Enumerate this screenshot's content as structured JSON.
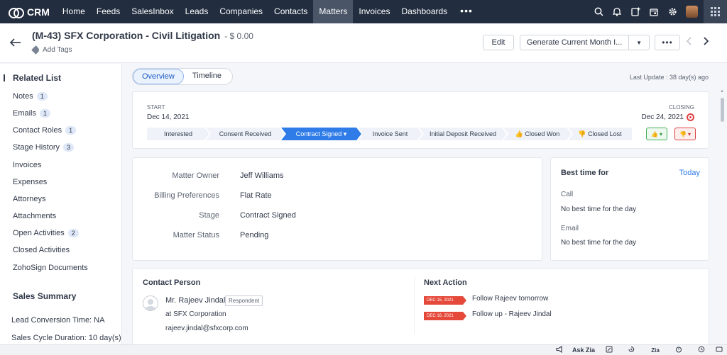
{
  "nav": {
    "app_name": "CRM",
    "tabs": [
      {
        "label": "Home"
      },
      {
        "label": "Feeds"
      },
      {
        "label": "SalesInbox"
      },
      {
        "label": "Leads"
      },
      {
        "label": "Companies"
      },
      {
        "label": "Contacts"
      },
      {
        "label": "Matters",
        "active": true
      },
      {
        "label": "Invoices"
      },
      {
        "label": "Dashboards"
      }
    ],
    "more": "•••"
  },
  "record": {
    "title": "(M-43) SFX Corporation - Civil Litigation",
    "amount": "- $ 0.00",
    "add_tags": "Add Tags",
    "edit": "Edit",
    "generate": "Generate Current Month I..."
  },
  "sidebar": {
    "related_title": "Related List",
    "items": [
      {
        "label": "Notes",
        "count": "1"
      },
      {
        "label": "Emails",
        "count": "1"
      },
      {
        "label": "Contact Roles",
        "count": "1"
      },
      {
        "label": "Stage History",
        "count": "3"
      },
      {
        "label": "Invoices"
      },
      {
        "label": "Expenses"
      },
      {
        "label": "Attorneys"
      },
      {
        "label": "Attachments"
      },
      {
        "label": "Open Activities",
        "count": "2"
      },
      {
        "label": "Closed Activities"
      },
      {
        "label": "ZohoSign Documents"
      }
    ],
    "summary_title": "Sales Summary",
    "summary": [
      {
        "label": "Lead Conversion Time: NA"
      },
      {
        "label": "Sales Cycle Duration: 10 day(s)"
      }
    ]
  },
  "view_tabs": {
    "overview": "Overview",
    "timeline": "Timeline"
  },
  "last_update": "Last Update : 38 day(s) ago",
  "stage": {
    "start_label": "START",
    "start_date": "Dec 14, 2021",
    "closing_label": "CLOSING",
    "closing_date": "Dec 24, 2021",
    "stages": [
      {
        "label": "Interested"
      },
      {
        "label": "Consent Received"
      },
      {
        "label": "Contract Signed ▾",
        "current": true
      },
      {
        "label": "Invoice Sent"
      },
      {
        "label": "Initial Deposit Received"
      },
      {
        "label": "👍 Closed Won"
      },
      {
        "label": "👎 Closed Lost"
      }
    ]
  },
  "fields": [
    {
      "label": "Matter Owner",
      "value": "Jeff Williams"
    },
    {
      "label": "Billing Preferences",
      "value": "Flat Rate"
    },
    {
      "label": "Stage",
      "value": "Contract Signed"
    },
    {
      "label": "Matter Status",
      "value": "Pending"
    }
  ],
  "best_time": {
    "title": "Best time for",
    "today": "Today",
    "call_label": "Call",
    "call_value": "No best time for the day",
    "email_label": "Email",
    "email_value": "No best time for the day"
  },
  "contact": {
    "title": "Contact Person",
    "name": "Mr. Rajeev Jindal",
    "role": "Respondent",
    "company": "at SFX Corporation",
    "email": "rajeev.jindal@sfxcorp.com"
  },
  "next_action": {
    "title": "Next Action",
    "items": [
      {
        "date": "DEC 15, 2021",
        "text": "Follow Rajeev tomorrow"
      },
      {
        "date": "DEC 16, 2021",
        "text": "Follow up - Rajeev Jindal"
      }
    ]
  },
  "bottom": {
    "ask_zia": "Ask Zia"
  }
}
